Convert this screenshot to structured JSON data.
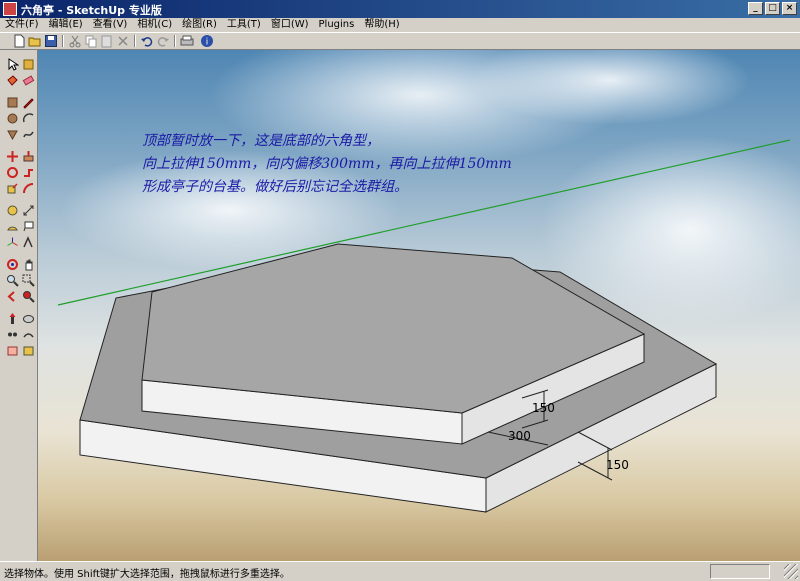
{
  "window": {
    "title": "六角亭 - SketchUp 专业版"
  },
  "menu": [
    "文件(F)",
    "编辑(E)",
    "查看(V)",
    "相机(C)",
    "绘图(R)",
    "工具(T)",
    "窗口(W)",
    "Plugins",
    "帮助(H)"
  ],
  "annotation": [
    "顶部暂时放一下，这是底部的六角型，",
    "向上拉伸150mm，向内偏移300mm，再向上拉伸150mm",
    "形成亭子的台基。做好后别忘记全选群组。"
  ],
  "dimensions": {
    "upper_height": "150",
    "offset": "300",
    "lower_height": "150"
  },
  "status": {
    "text": "选择物体。使用 Shift键扩大选择范围，拖拽鼠标进行多重选择。"
  },
  "colors": {
    "annotation_text": "#1a1aa6",
    "top_face": "#9f9f9f",
    "side_face": "#f2f2f2",
    "axis_green": "#1f9e2a",
    "titlebar": "#0a246a"
  }
}
